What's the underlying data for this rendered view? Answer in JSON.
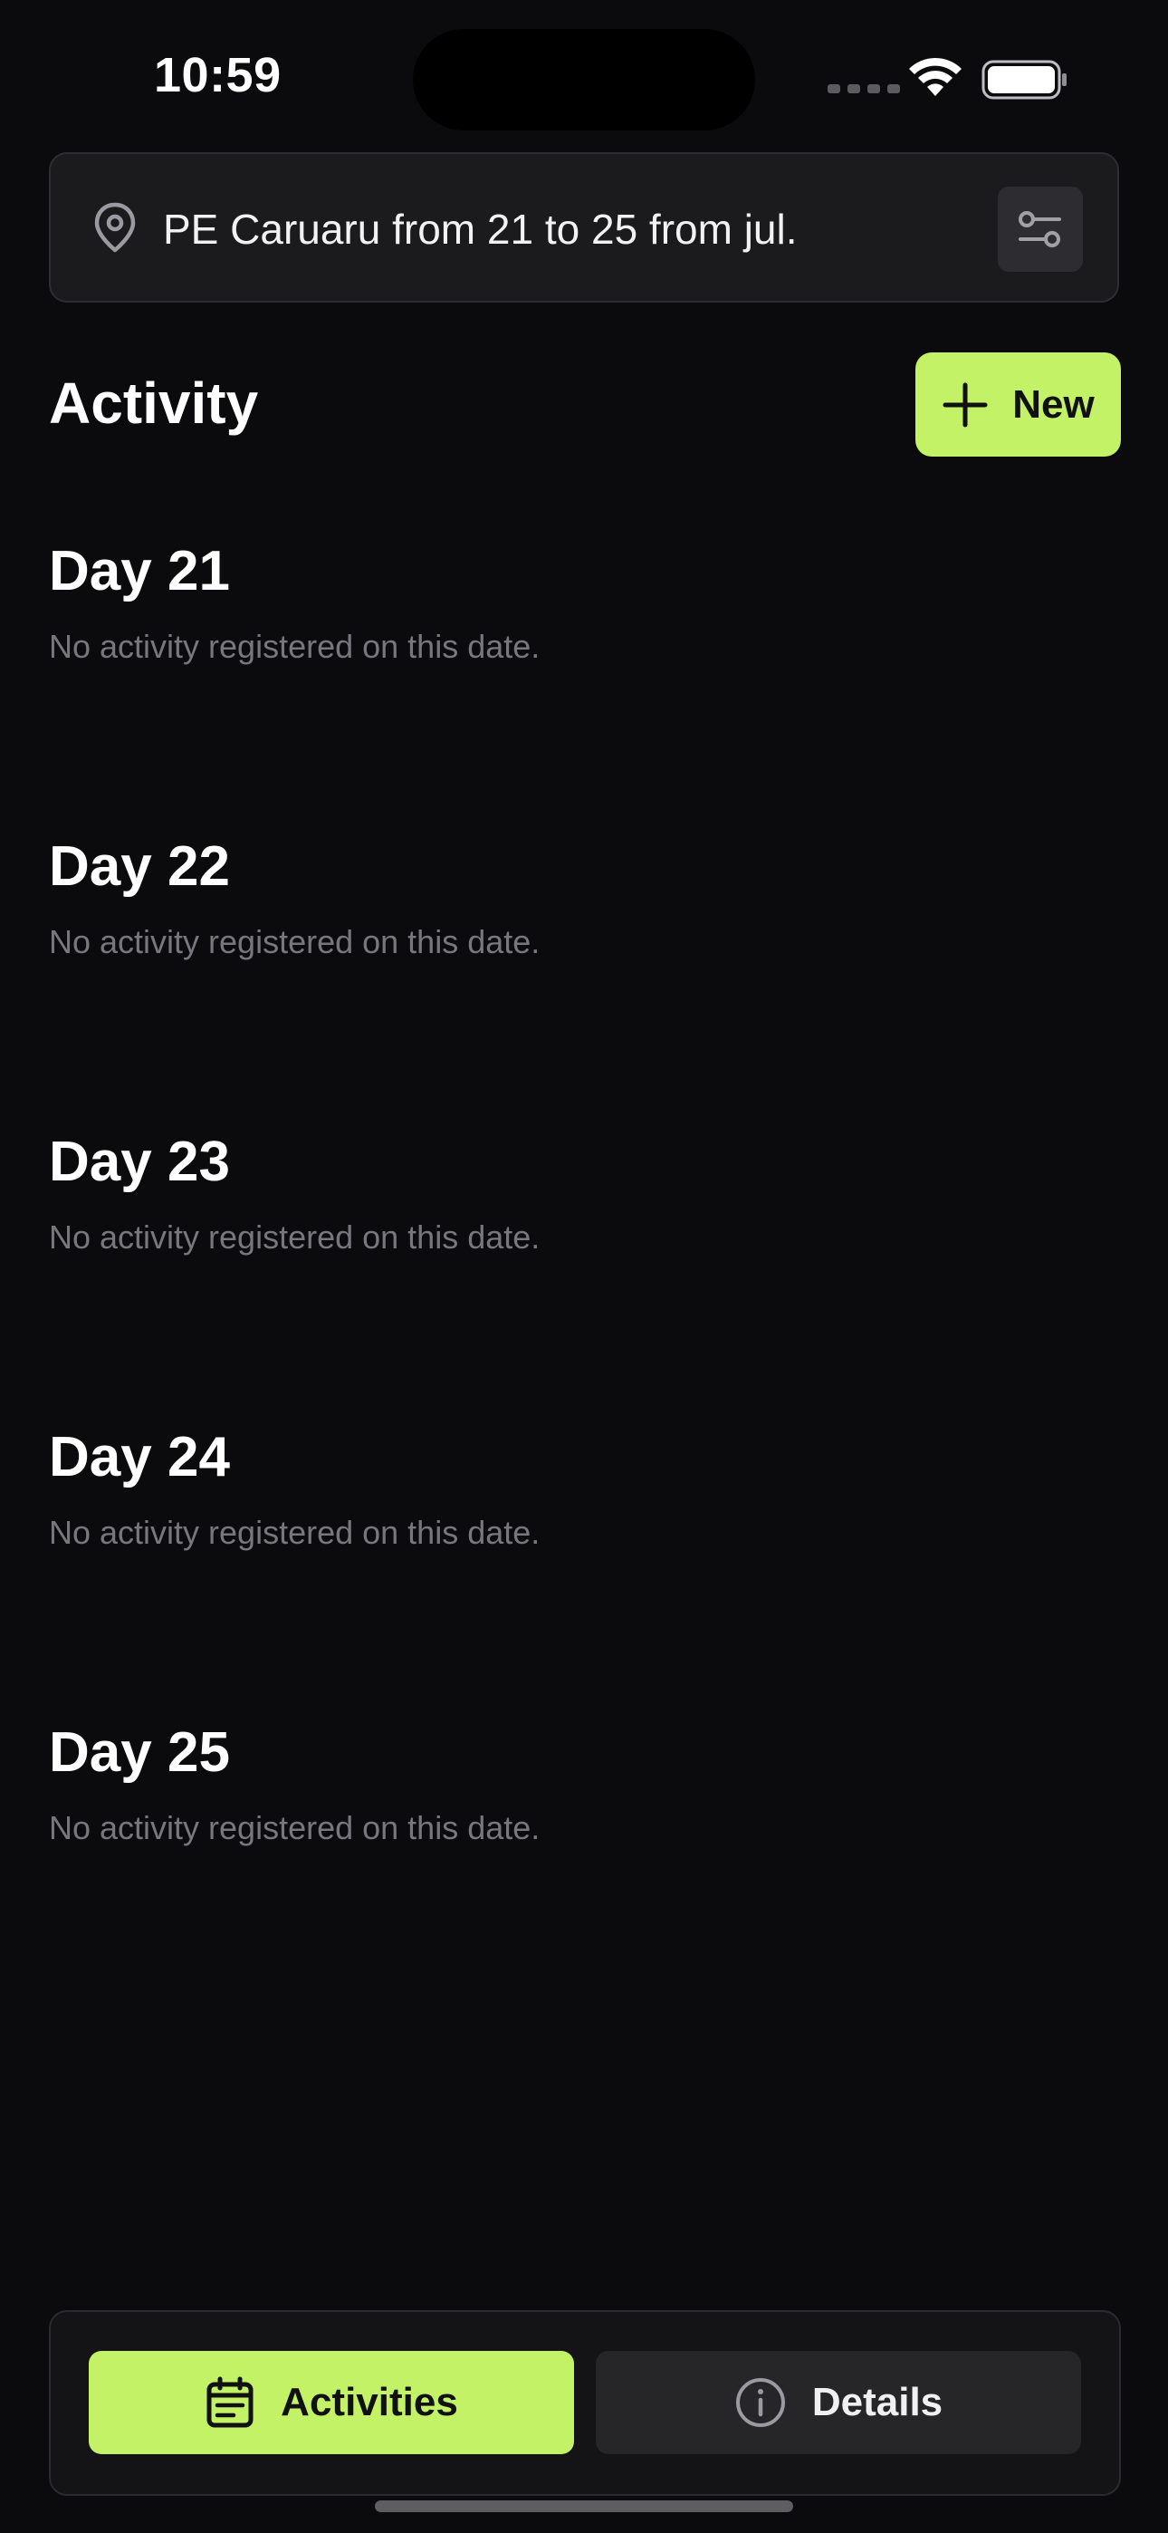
{
  "status_bar": {
    "time": "10:59"
  },
  "search": {
    "location_text": "PE Caruaru from 21 to 25 from jul."
  },
  "header": {
    "title": "Activity",
    "new_button_label": "New"
  },
  "days": [
    {
      "title": "Day 21",
      "empty_text": "No activity registered on this date."
    },
    {
      "title": "Day 22",
      "empty_text": "No activity registered on this date."
    },
    {
      "title": "Day 23",
      "empty_text": "No activity registered on this date."
    },
    {
      "title": "Day 24",
      "empty_text": "No activity registered on this date."
    },
    {
      "title": "Day 25",
      "empty_text": "No activity registered on this date."
    }
  ],
  "tabs": [
    {
      "label": "Activities",
      "icon": "calendar-icon",
      "active": true
    },
    {
      "label": "Details",
      "icon": "info-icon",
      "active": false
    }
  ],
  "colors": {
    "accent": "#c3f266",
    "background": "#0b0b0d",
    "muted_text": "#77777d"
  }
}
